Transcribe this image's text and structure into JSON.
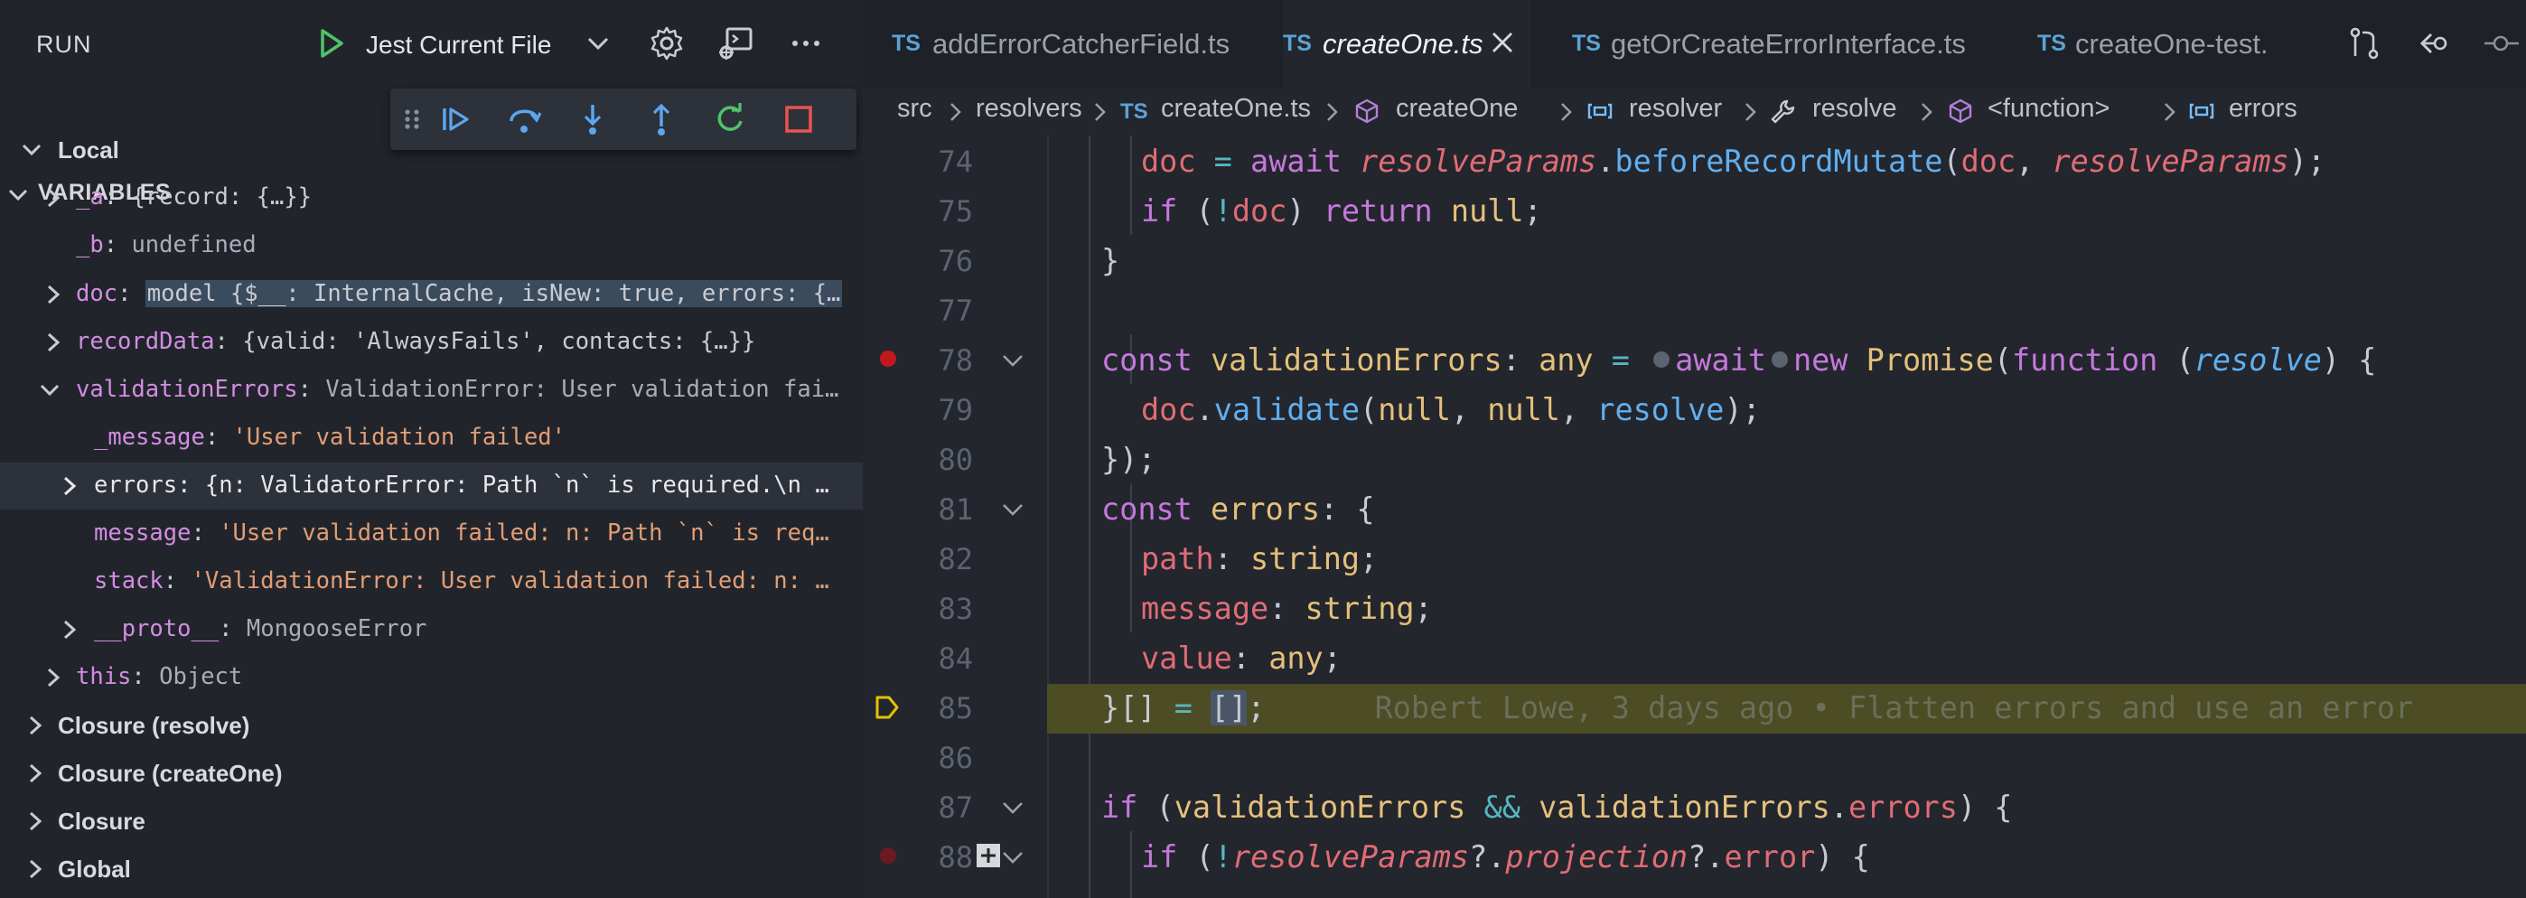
{
  "sidebar": {
    "run_label": "RUN",
    "config_label": "Jest Current File",
    "variables_title": "VARIABLES",
    "tree": [
      {
        "label": "Local"
      },
      {
        "name": "_a",
        "value": "{record: {…}}"
      },
      {
        "name": "_b",
        "value": "undefined"
      },
      {
        "name": "doc",
        "value": "model {$__: InternalCache, isNew: true, errors: {…"
      },
      {
        "name": "recordData",
        "value": "{valid: 'AlwaysFails', contacts: {…}}"
      },
      {
        "name": "validationErrors",
        "value": "ValidationError: User validation fai…"
      },
      {
        "name": "_message",
        "value": "'User validation failed'"
      },
      {
        "name": "errors",
        "value": "{n: ValidatorError: Path `n` is required.\\n …"
      },
      {
        "name": "message",
        "value": "'User validation failed: n: Path `n` is req…"
      },
      {
        "name": "stack",
        "value": "'ValidationError: User validation failed: n: …"
      },
      {
        "name": "__proto__",
        "value": "MongooseError"
      },
      {
        "name": "this",
        "value": "Object"
      },
      {
        "label": "Closure (resolve)"
      },
      {
        "label": "Closure (createOne)"
      },
      {
        "label": "Closure"
      },
      {
        "label": "Global"
      }
    ]
  },
  "tabs": [
    {
      "badge": "TS",
      "label": "addErrorCatcherField.ts"
    },
    {
      "badge": "TS",
      "label": "createOne.ts"
    },
    {
      "badge": "TS",
      "label": "getOrCreateErrorInterface.ts"
    },
    {
      "badge": "TS",
      "label": "createOne-test."
    }
  ],
  "breadcrumb": [
    "src",
    "resolvers",
    "createOne.ts",
    "createOne",
    "resolver",
    "resolve",
    "<function>",
    "errors"
  ],
  "code": {
    "line_numbers": [
      "74",
      "75",
      "76",
      "77",
      "78",
      "79",
      "80",
      "81",
      "82",
      "83",
      "84",
      "85",
      "86",
      "87",
      "88"
    ],
    "l74": {
      "a": "doc",
      "b": " = ",
      "c": "await",
      "d": " ",
      "e": "resolveParams",
      "f": ".",
      "g": "beforeRecordMutate",
      "h": "(",
      "i": "doc",
      "j": ", ",
      "k": "resolveParams",
      "l": ");"
    },
    "l75": {
      "a": "if",
      "b": " (",
      "c": "!",
      "d": "doc",
      "e": ") ",
      "f": "return",
      "g": " ",
      "h": "null",
      "i": ";"
    },
    "l76": {
      "a": "}"
    },
    "l78": {
      "a": "const",
      "b": " ",
      "c": "validationErrors",
      "d": ": ",
      "e": "any",
      "f": " = ",
      "g": "await",
      "h": "new",
      "i": " ",
      "j": "Promise",
      "k": "(",
      "l": "function",
      "m": " (",
      "n": "resolve",
      "o": ") {"
    },
    "l79": {
      "a": "doc",
      "b": ".",
      "c": "validate",
      "d": "(",
      "e": "null",
      "f": ", ",
      "g": "null",
      "h": ", ",
      "i": "resolve",
      "j": ");"
    },
    "l80": {
      "a": "});"
    },
    "l81": {
      "a": "const",
      "b": " ",
      "c": "errors",
      "d": ": {"
    },
    "l82": {
      "a": "path",
      "b": ": ",
      "c": "string",
      "d": ";"
    },
    "l83": {
      "a": "message",
      "b": ": ",
      "c": "string",
      "d": ";"
    },
    "l84": {
      "a": "value",
      "b": ": ",
      "c": "any",
      "d": ";"
    },
    "l85": {
      "a": "}[] ",
      "b": "=",
      "c": " ",
      "d": "[]",
      "e": ";",
      "blame": "Robert Lowe, 3 days ago • Flatten errors and use an error"
    },
    "l87": {
      "a": "if",
      "b": " (",
      "c": "validationErrors",
      "d": " ",
      "e": "&&",
      "f": " ",
      "g": "validationErrors",
      "h": ".",
      "i": "errors",
      "j": ") {"
    },
    "l88": {
      "a": "if",
      "b": " (",
      "c": "!",
      "d": "resolveParams",
      "e": "?.",
      "f": "projection",
      "g": "?.",
      "h": "error",
      "i": ") {"
    }
  },
  "colors": {
    "keyword": "#c678dd",
    "function": "#61afef",
    "param": "#e06c75",
    "type": "#e5c07b",
    "breakpoint": "#c0191d",
    "current_line": "#4c4c25"
  }
}
